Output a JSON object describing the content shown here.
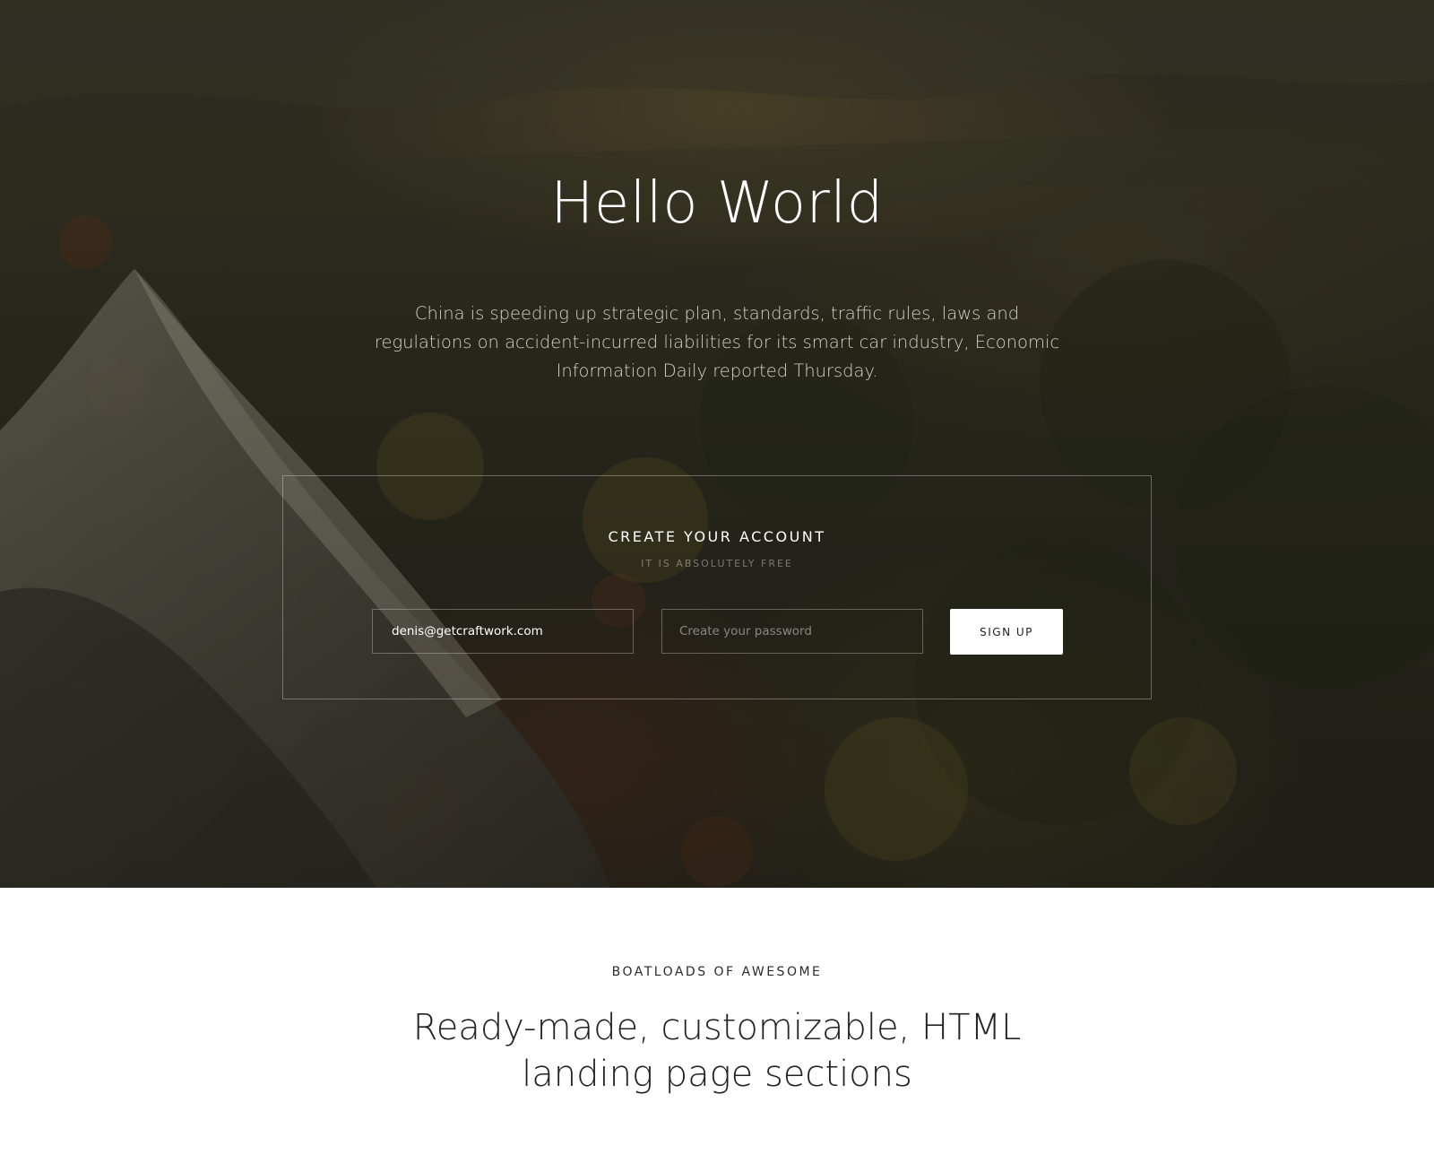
{
  "hero": {
    "title": "Hello World",
    "description": "China is speeding up strategic plan, standards, traffic rules, laws and regulations on accident-incurred liabilities for its smart car industry, Economic Information Daily reported Thursday."
  },
  "signup": {
    "title": "CREATE YOUR ACCOUNT",
    "subtitle": "IT IS ABSOLUTELY FREE",
    "email_value": "denis@getcraftwork.com",
    "password_placeholder": "Create your password",
    "button_label": "SIGN UP"
  },
  "features": {
    "eyebrow": "BOATLOADS OF AWESOME",
    "heading": "Ready-made, customizable, HTML landing page sections"
  },
  "colors": {
    "hero_overlay": "#2f2e22",
    "button_bg": "#ffffff",
    "text_dark": "#222222"
  }
}
